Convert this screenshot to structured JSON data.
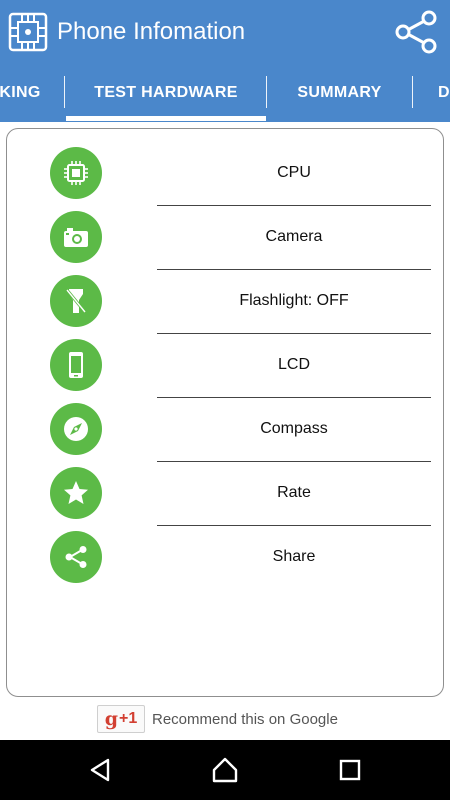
{
  "app_bar": {
    "title": "Phone Infomation",
    "logo_icon": "circuit-chip-icon",
    "share_icon": "share-icon",
    "background_color": "#4a87cb"
  },
  "tabs": [
    {
      "label": "KING",
      "active": false
    },
    {
      "label": "TEST HARDWARE",
      "active": true
    },
    {
      "label": "SUMMARY",
      "active": false
    },
    {
      "label": "D",
      "active": false
    }
  ],
  "menu_items": [
    {
      "label": "CPU",
      "icon": "chip-icon"
    },
    {
      "label": "Camera",
      "icon": "camera-icon"
    },
    {
      "label": "Flashlight: OFF",
      "icon": "flashlight-off-icon"
    },
    {
      "label": "LCD",
      "icon": "phone-screen-icon"
    },
    {
      "label": "Compass",
      "icon": "compass-icon"
    },
    {
      "label": "Rate",
      "icon": "star-icon"
    },
    {
      "label": "Share",
      "icon": "share-icon"
    }
  ],
  "accent_color": "#5cba47",
  "google_plus": {
    "g_label": "g",
    "plus_label": "+1",
    "recommend_text": "Recommend this on Google"
  },
  "nav_bar": {
    "back_icon": "back-triangle-icon",
    "home_icon": "home-icon",
    "recents_icon": "recents-square-icon"
  }
}
